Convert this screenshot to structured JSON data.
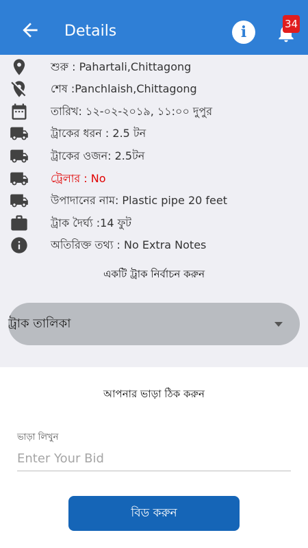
{
  "header": {
    "title": "Details",
    "notification_count": "34",
    "info_glyph": "i",
    "icons": [
      "back-arrow-icon",
      "info-icon",
      "bell-icon"
    ],
    "color": "#2f7fd6"
  },
  "details": [
    {
      "icon": "location-pin-icon",
      "text": "শুরু : Pahartali,Chittagong"
    },
    {
      "icon": "location-off-icon",
      "text": "শেষ :Panchlaish,Chittagong"
    },
    {
      "icon": "calendar-icon",
      "text": "তারিখ: ১২-০২-২০১৯, ১১:০০ দুপুর"
    },
    {
      "icon": "truck-icon",
      "text": "ট্রাকের ধরন : 2.5 টন"
    },
    {
      "icon": "truck-icon",
      "text": "ট্রাকের ওজন: 2.5টন"
    },
    {
      "icon": "truck-icon",
      "text": "ট্রেলার : No",
      "color": "#e00000"
    },
    {
      "icon": "truck-icon",
      "text": "উপাদানের নাম: Plastic pipe 20 feet"
    },
    {
      "icon": "briefcase-icon",
      "text": "ট্রাক দৈর্ঘ্য :14 ফুট"
    },
    {
      "icon": "info-circle-icon",
      "text": "অতিরিক্ত তথ্য : No Extra Notes"
    }
  ],
  "truck_select": {
    "heading": "একটি ট্রাক নির্বাচন করুন",
    "dropdown_value": "ট্রাক তালিকা"
  },
  "bid": {
    "heading": "আপনার ভাড়া ঠিক করুন",
    "label": "ভাড়া লিখুন",
    "placeholder": "Enter Your Bid",
    "value": "",
    "button_label": "বিড করুন",
    "button_color": "#1565b7"
  }
}
